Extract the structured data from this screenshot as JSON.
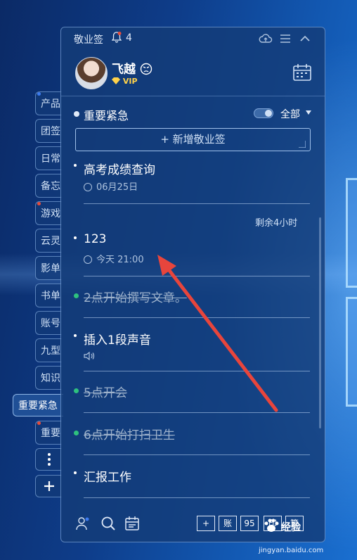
{
  "app": {
    "title": "敬业签",
    "notification_count": "4"
  },
  "user": {
    "name": "飞越",
    "badge": "VIP"
  },
  "category": {
    "label": "重要紧急",
    "filter": "全部"
  },
  "add_button": "+ 新增敬业签",
  "notes": [
    {
      "title": "高考成绩查询",
      "meta": "06月25日",
      "meta_type": "date",
      "done": false
    },
    {
      "remaining": "剩余4小时",
      "title": "123",
      "meta": "今天 21:00",
      "meta_type": "time",
      "done": false
    },
    {
      "title": "2点开始撰写文章。",
      "done": true
    },
    {
      "title": "插入1段声音",
      "meta_type": "audio",
      "done": false
    },
    {
      "title": "5点开会",
      "done": true
    },
    {
      "title": "6点开始打扫卫生",
      "done": true
    },
    {
      "title": "汇报工作",
      "done": false
    }
  ],
  "sidebar_tabs": [
    "产品",
    "团签",
    "日常",
    "备忘",
    "游戏",
    "云灵",
    "影单",
    "书单",
    "账号",
    "九型",
    "知识",
    "重要"
  ],
  "sidebar_active": "重要紧急",
  "bottom_bar": {
    "box_buttons": [
      "+",
      "账",
      "95",
      "印",
      "算"
    ]
  },
  "watermark": {
    "brand": "经验",
    "url": "jingyan.baidu.com"
  },
  "colors": {
    "accent_green": "#2ec27e",
    "dot_red": "#e74c3c",
    "dot_blue": "#3d7bf0",
    "arrow_red": "#e8453c"
  }
}
